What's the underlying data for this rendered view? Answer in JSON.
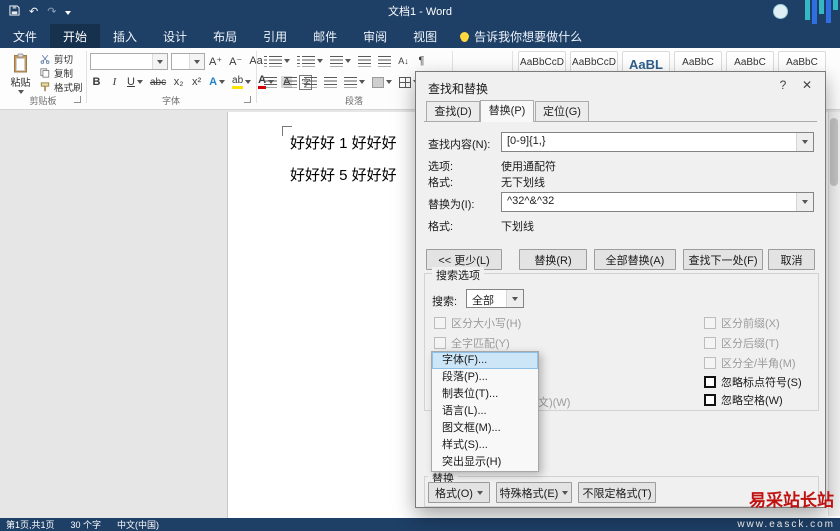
{
  "titlebar": {
    "title": "文档1 - Word"
  },
  "tabs": [
    {
      "label": "文件"
    },
    {
      "label": "开始"
    },
    {
      "label": "插入"
    },
    {
      "label": "设计"
    },
    {
      "label": "布局"
    },
    {
      "label": "引用"
    },
    {
      "label": "邮件"
    },
    {
      "label": "审阅"
    },
    {
      "label": "视图"
    }
  ],
  "tell_me": "告诉我你想要做什么",
  "ribbon": {
    "paste_label": "粘贴",
    "cut_label": "剪切",
    "copy_label": "复制",
    "format_painter_label": "格式刷",
    "clipboard_group_label": "剪贴板",
    "font_group_label": "字体",
    "paragraph_group_label": "段落",
    "font_name_value": "",
    "font_size_value": "",
    "font_row1_buttons": [
      "A⁺",
      "A⁻",
      "Aa"
    ],
    "font_row2_buttons": [
      "B",
      "I",
      "U",
      "abc",
      "x₂",
      "x²"
    ],
    "icon_glyphs": {
      "text_effects": "A",
      "highlight": "ab",
      "font_color": "A",
      "char_shading": "A",
      "enclose": "字",
      "sort": "A↓",
      "pilcrow": "¶"
    },
    "style_previews": [
      "AaBbCcD",
      "AaBbCcD",
      "AaBL",
      "AaBbC",
      "AaBbC",
      "AaBbC"
    ]
  },
  "document": {
    "line1": "好好好 1 好好好",
    "line2": "好好好 5 好好好"
  },
  "dialog": {
    "title": "查找和替换",
    "help": "?",
    "close": "✕",
    "tabs": [
      {
        "label": "查找(D)"
      },
      {
        "label": "替换(P)"
      },
      {
        "label": "定位(G)"
      }
    ],
    "find_label": "查找内容(N):",
    "find_value": "[0-9]{1,}",
    "options_label": "选项:",
    "options_value": "使用通配符",
    "format_label_1": "格式:",
    "format_value_1": "无下划线",
    "replace_label": "替换为(I):",
    "replace_value": "^32^&^32",
    "format_label_2": "格式:",
    "format_value_2": "下划线",
    "less_button": "<< 更少(L)",
    "replace_button": "替换(R)",
    "replace_all_button": "全部替换(A)",
    "find_next_button": "查找下一处(F)",
    "cancel_button": "取消",
    "search_options_title": "搜索选项",
    "search_label": "搜索:",
    "search_value": "全部",
    "checkboxes_left": [
      {
        "label": "区分大小写(H)"
      },
      {
        "label": "全字匹配(Y)"
      }
    ],
    "partial_checkbox_label": "文)(W)",
    "checkboxes_right": [
      {
        "label": "区分前缀(X)"
      },
      {
        "label": "区分后缀(T)"
      },
      {
        "label": "区分全/半角(M)"
      },
      {
        "label": "忽略标点符号(S)"
      },
      {
        "label": "忽略空格(W)"
      }
    ],
    "menu_items": [
      {
        "label": "字体(F)..."
      },
      {
        "label": "段落(P)..."
      },
      {
        "label": "制表位(T)..."
      },
      {
        "label": "语言(L)..."
      },
      {
        "label": "图文框(M)..."
      },
      {
        "label": "样式(S)..."
      },
      {
        "label": "突出显示(H)"
      }
    ],
    "replace_group_title": "替换",
    "format_button": "格式(O)",
    "special_button": "特殊格式(E)",
    "no_format_button": "不限定格式(T)"
  },
  "statusbar": {
    "page_info": "第1页,共1页",
    "word_count": "30 个字",
    "language": "中文(中国)"
  },
  "watermark": {
    "brand": "易采站长站",
    "url": "www.easck.com"
  }
}
